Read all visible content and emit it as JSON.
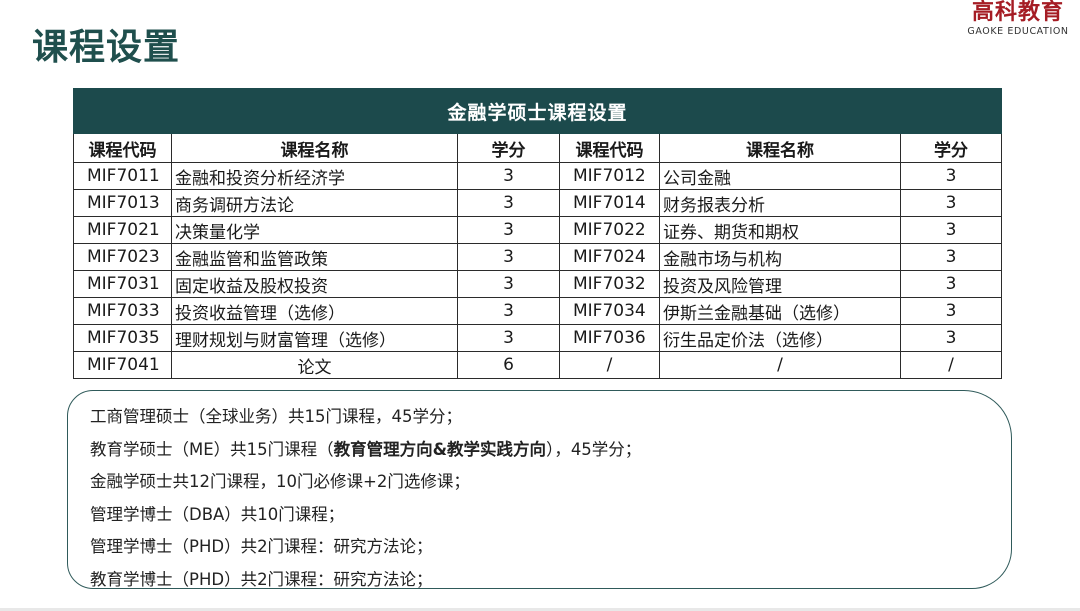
{
  "header": {
    "title": "课程设置",
    "logo_main": "高科教育",
    "logo_sub": "GAOKE EDUCATION"
  },
  "table": {
    "caption": "金融学硕士课程设置",
    "headers": [
      "课程代码",
      "课程名称",
      "学分",
      "课程代码",
      "课程名称",
      "学分"
    ],
    "rows": [
      {
        "code1": "MIF7011",
        "name1": "金融和投资分析经济学",
        "credit1": "3",
        "code2": "MIF7012",
        "name2": "公司金融",
        "credit2": "3"
      },
      {
        "code1": "MIF7013",
        "name1": "商务调研方法论",
        "credit1": "3",
        "code2": "MIF7014",
        "name2": "财务报表分析",
        "credit2": "3"
      },
      {
        "code1": "MIF7021",
        "name1": "决策量化学",
        "credit1": "3",
        "code2": "MIF7022",
        "name2": "证券、期货和期权",
        "credit2": "3"
      },
      {
        "code1": "MIF7023",
        "name1": "金融监管和监管政策",
        "credit1": "3",
        "code2": "MIF7024",
        "name2": "金融市场与机构",
        "credit2": "3"
      },
      {
        "code1": "MIF7031",
        "name1": "固定收益及股权投资",
        "credit1": "3",
        "code2": "MIF7032",
        "name2": "投资及风险管理",
        "credit2": "3"
      },
      {
        "code1": "MIF7033",
        "name1": "投资收益管理（选修）",
        "credit1": "3",
        "code2": "MIF7034",
        "name2": "伊斯兰金融基础（选修）",
        "credit2": "3"
      },
      {
        "code1": "MIF7035",
        "name1": "理财规划与财富管理（选修）",
        "credit1": "3",
        "code2": "MIF7036",
        "name2": "衍生品定价法（选修）",
        "credit2": "3"
      },
      {
        "code1": "MIF7041",
        "name1": "论文",
        "credit1": "6",
        "code2": "/",
        "name2": "/",
        "credit2": "/"
      }
    ]
  },
  "notes": {
    "line1": "工商管理硕士（全球业务）共15门课程，45学分；",
    "line2_pre": "教育学硕士（ME）共15门课程（",
    "line2_bold": "教育管理方向&教学实践方向",
    "line2_post": "），45学分；",
    "line3": "金融学硕士共12门课程，10门必修课+2门选修课；",
    "line4": "管理学博士（DBA）共10门课程；",
    "line5": "管理学博士（PHD）共2门课程：研究方法论；",
    "line6": "教育学博士（PHD）共2门课程：研究方法论；"
  }
}
